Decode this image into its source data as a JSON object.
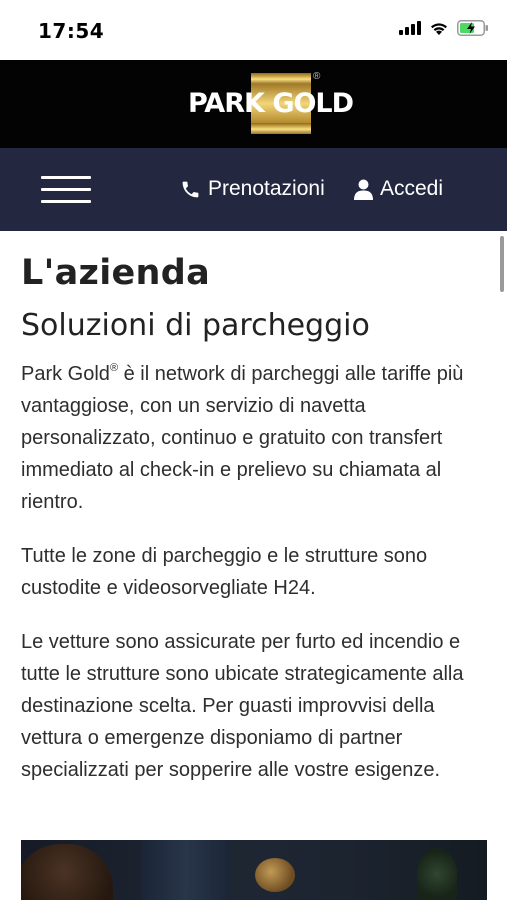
{
  "status_bar": {
    "time": "17:54",
    "icons": [
      "cellular-signal-icon",
      "wifi-icon",
      "battery-charging-icon"
    ]
  },
  "brand": {
    "logo_text": "PARK GOLD",
    "trademark": "®",
    "colors": {
      "gold": "#d4b04a",
      "background": "#030303"
    }
  },
  "nav": {
    "menu_icon": "hamburger-menu-icon",
    "links": [
      {
        "label": "Prenotazioni",
        "icon": "phone-icon"
      },
      {
        "label": "Accedi",
        "icon": "user-icon"
      }
    ],
    "colors": {
      "background": "#232740",
      "text": "#ffffff"
    }
  },
  "content": {
    "title": "L'azienda",
    "subtitle": "Soluzioni di parcheggio",
    "p1_brand": "Park Gold",
    "p1_reg": "®",
    "p1_rest": " è il network di parcheggi alle tariffe più vantaggiose, con un servizio di navetta personalizzato, continuo e gratuito con transfert immediato al check-in e prelievo su chiamata al rientro.",
    "p2": "Tutte le zone di parcheggio e le strutture sono custodite e videosorvegliate H24.",
    "p3": "Le vetture sono assicurate per furto ed incendio e tutte le strutture sono ubicate strategicamente alla destinazione scelta. Per guasti improvvisi della vettura o emergenze disponiamo di partner specializzati per sopperire alle vostre esigenze."
  }
}
